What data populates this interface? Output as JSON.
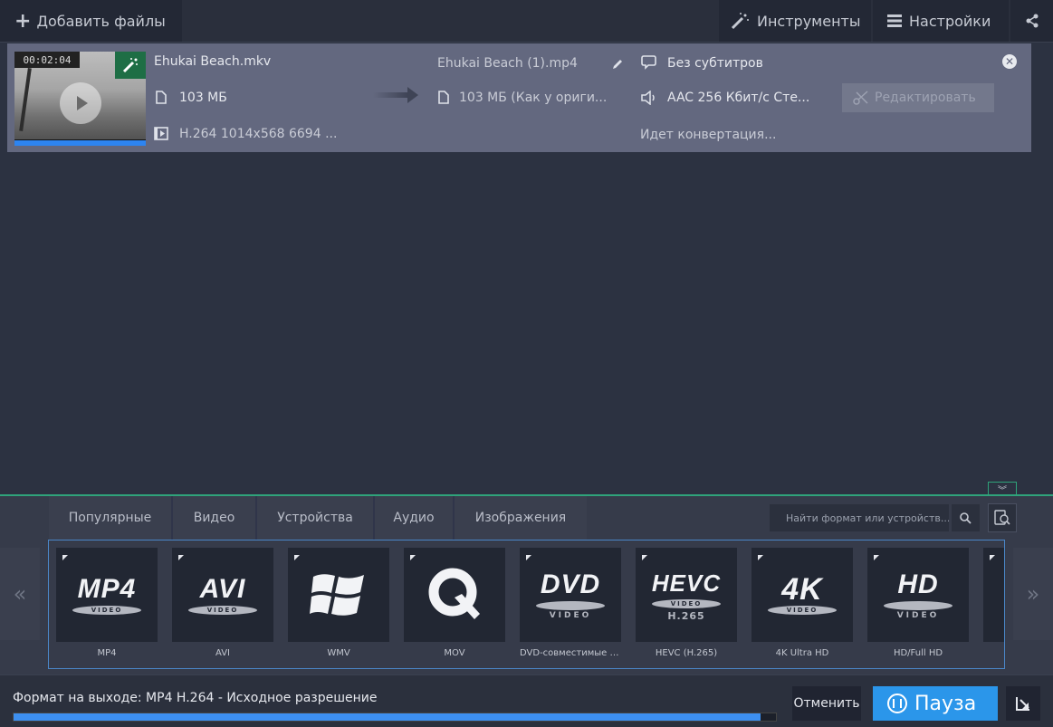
{
  "toolbar": {
    "add_files_label": "Добавить файлы",
    "tools_label": "Инструменты",
    "settings_label": "Настройки"
  },
  "file": {
    "duration": "00:02:04",
    "source_name": "Ehukai Beach.mkv",
    "source_size": "103 МБ",
    "source_info": "H.264 1014x568 6694 ...",
    "output_name": "Ehukai Beach (1).mp4",
    "output_size": "103 МБ (Как у ориги...",
    "subtitles": "Без субтитров",
    "audio": "AAC 256 Кбит/с Сте...",
    "status": "Идет конвертация...",
    "edit_label": "Редактировать",
    "thumb_progress": 1.0
  },
  "format_panel": {
    "tabs": [
      "Популярные",
      "Видео",
      "Устройства",
      "Аудио",
      "Изображения"
    ],
    "search_placeholder": "Найти формат или устройств...",
    "formats": [
      {
        "logo": "MP4",
        "disc": "VIDEO",
        "name": "MP4"
      },
      {
        "logo": "AVI",
        "disc": "VIDEO",
        "name": "AVI"
      },
      {
        "logo": "",
        "icon": "windows-icon",
        "name": "WMV"
      },
      {
        "logo": "",
        "icon": "quicktime-icon",
        "name": "MOV"
      },
      {
        "logo": "DVD",
        "sub2": "VIDEO",
        "name": "DVD-совместимые в..."
      },
      {
        "logo": "HEVC",
        "disc": "VIDEO",
        "sub": "H.265",
        "name": "HEVC (H.265)"
      },
      {
        "logo": "4K",
        "disc": "VIDEO",
        "name": "4K Ultra HD"
      },
      {
        "logo": "HD",
        "sub2": "VIDEO",
        "name": "HD/Full HD"
      }
    ]
  },
  "footer": {
    "output_format": "Формат на выходе:  MP4 H.264 - Исходное разрешение",
    "progress": 0.98,
    "cancel_label": "Отменить",
    "pause_label": "Пауза"
  },
  "colors": {
    "accent_blue": "#2b96ea",
    "accent_green": "#2fa37a",
    "file_row": "#63687f"
  }
}
